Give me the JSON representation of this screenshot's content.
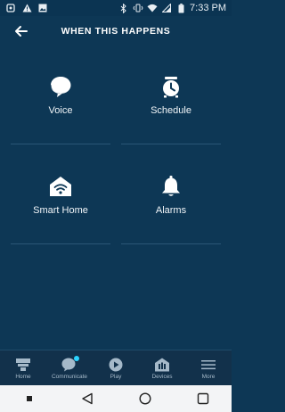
{
  "status_bar": {
    "time": "7:33 PM",
    "left_icons": [
      "notification-icon",
      "warning-icon",
      "image-icon"
    ],
    "right_icons": [
      "bluetooth-icon",
      "vibrate-icon",
      "wifi-icon",
      "signal-icon",
      "battery-icon"
    ]
  },
  "header": {
    "title": "WHEN THIS HAPPENS",
    "back_icon": "back-arrow-icon"
  },
  "triggers": [
    {
      "label": "Voice",
      "icon": "speech-bubble-icon"
    },
    {
      "label": "Schedule",
      "icon": "alarm-clock-icon"
    },
    {
      "label": "Smart Home",
      "icon": "smart-home-icon"
    },
    {
      "label": "Alarms",
      "icon": "bell-icon"
    }
  ],
  "bottom_nav": [
    {
      "label": "Home",
      "icon": "home-icon"
    },
    {
      "label": "Communicate",
      "icon": "chat-icon",
      "badge": true
    },
    {
      "label": "Play",
      "icon": "play-icon"
    },
    {
      "label": "Devices",
      "icon": "devices-icon"
    },
    {
      "label": "More",
      "icon": "menu-icon"
    }
  ],
  "colors": {
    "background": "#0d3755",
    "nav_background": "#12314b",
    "nav_text": "#a5b9c9",
    "badge": "#2bd4ff",
    "system_nav": "#f3f4f6"
  }
}
